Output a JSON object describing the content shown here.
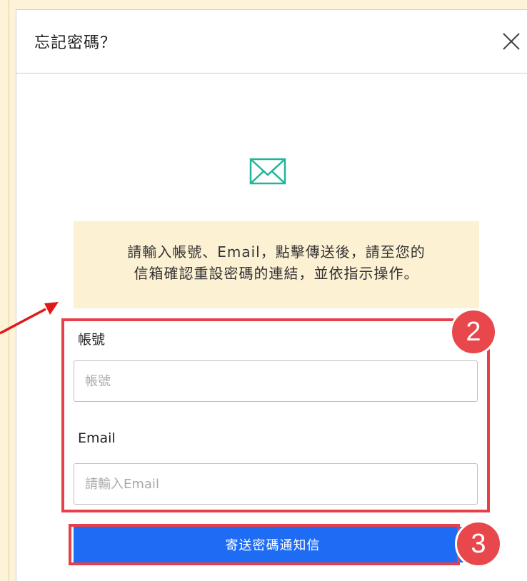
{
  "modal": {
    "title": "忘記密碼？",
    "close_icon": "close-icon",
    "envelope_icon": "envelope-icon",
    "notice_line1": "請輸入帳號、Email，點擊傳送後，請至您的",
    "notice_line2": "信箱確認重設密碼的連結，並依指示操作。",
    "account": {
      "label": "帳號",
      "placeholder": "帳號",
      "value": ""
    },
    "email": {
      "label": "Email",
      "placeholder": "請輸入Email",
      "value": ""
    },
    "submit_label": "寄送密碼通知信"
  },
  "annotations": {
    "step2": "2",
    "step3": "3",
    "highlight_color": "#e8404a",
    "arrow_color": "#e01818"
  },
  "colors": {
    "accent": "#1f6cf4",
    "notice_bg": "#fdf1d4",
    "page_bg": "#fdf3d8",
    "envelope": "#22b59a"
  }
}
